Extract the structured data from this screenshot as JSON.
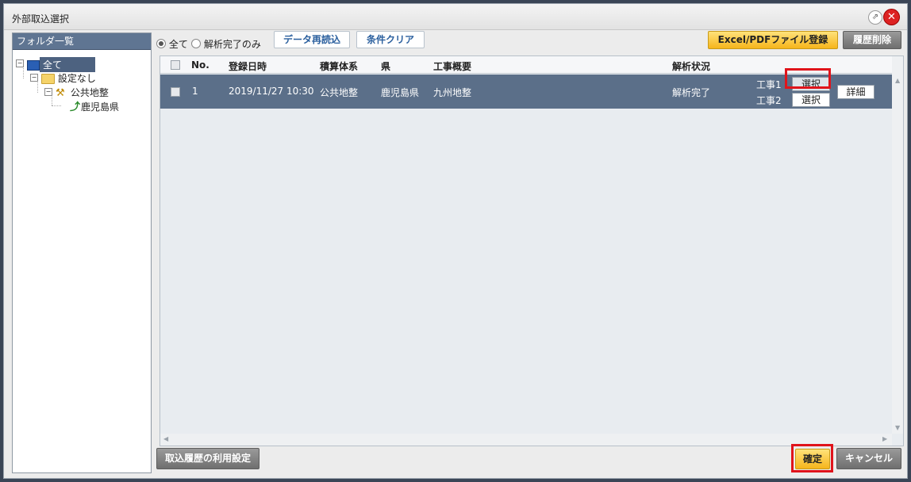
{
  "window": {
    "title": "外部取込選択"
  },
  "folder_panel": {
    "header": "フォルダ一覧",
    "tree": [
      {
        "label": "全て",
        "icon": "monitor-icon",
        "selected": true
      },
      {
        "label": "設定なし",
        "icon": "folder-icon"
      },
      {
        "label": "公共地整",
        "icon": "pickaxe-icon"
      },
      {
        "label": "鹿児島県",
        "icon": "road-icon"
      }
    ]
  },
  "filter": {
    "options": [
      "全て",
      "解析完了のみ"
    ],
    "selected": "全て",
    "reload_label": "データ再読込",
    "clear_label": "条件クリア"
  },
  "toolbar": {
    "excel_register_label": "Excel/PDFファイル登録",
    "history_delete_label": "履歴削除"
  },
  "table": {
    "columns": [
      "No.",
      "登録日時",
      "積算体系",
      "県",
      "工事概要",
      "解析状況"
    ],
    "rows": [
      {
        "no": "1",
        "registered": "2019/11/27 10:30",
        "system": "公共地整",
        "prefecture": "鹿児島県",
        "summary": "九州地整",
        "status": "解析完了",
        "works": [
          {
            "label": "工事1",
            "button": "選択"
          },
          {
            "label": "工事2",
            "button": "選択"
          }
        ],
        "detail_label": "詳細"
      }
    ]
  },
  "footer": {
    "history_settings_label": "取込履歴の利用設定",
    "confirm_label": "確定",
    "cancel_label": "キャンセル"
  },
  "colors": {
    "selected_row": "#5b6f89",
    "highlight_box": "#e0141b",
    "confirm_button": "#f6b51c"
  }
}
